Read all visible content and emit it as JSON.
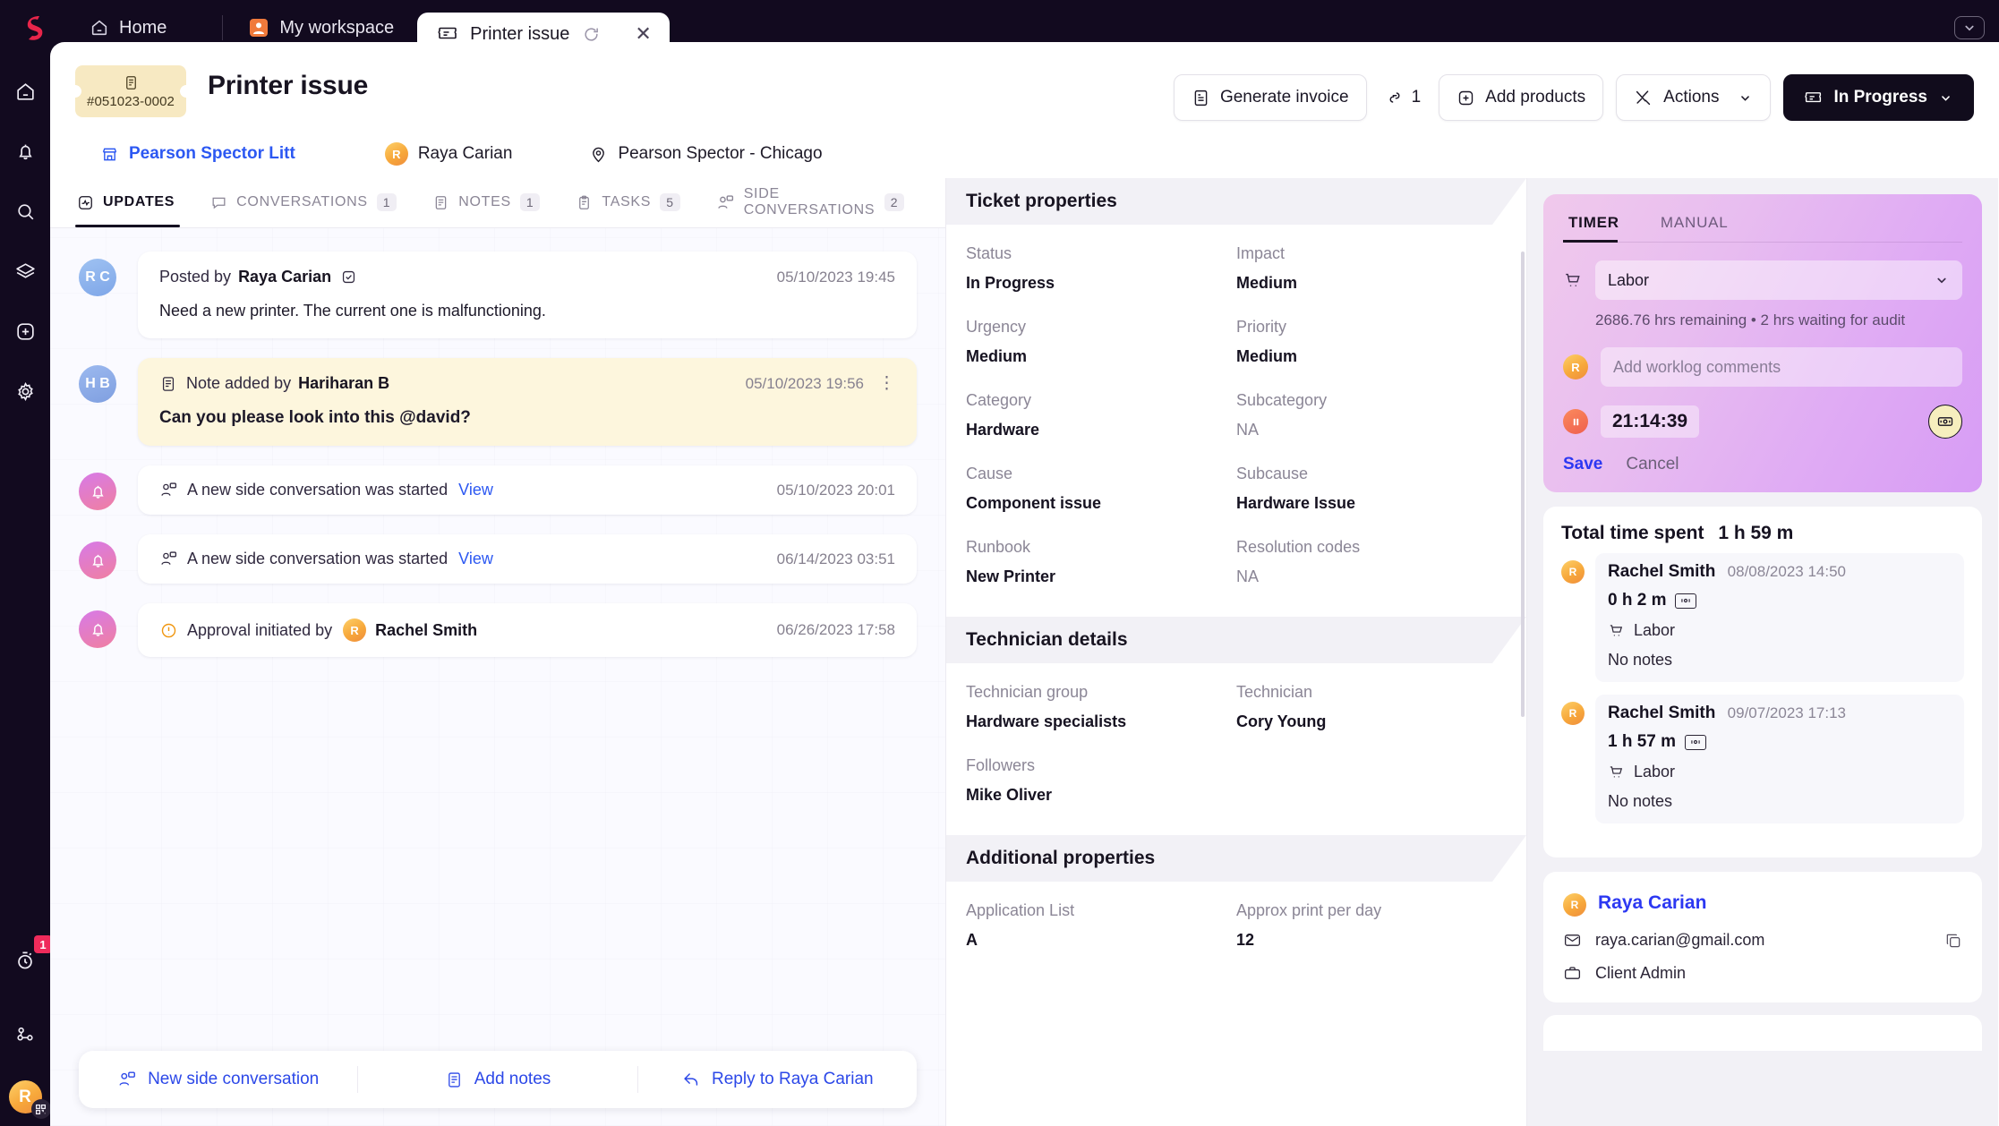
{
  "topbar": {
    "brand_icon": "sprinklr-logo-icon",
    "tabs": [
      {
        "label": "Home",
        "icon": "home-icon",
        "active": false
      },
      {
        "label": "My workspace",
        "icon": "workspace-person-icon",
        "active": false
      },
      {
        "label": "Printer issue",
        "icon": "ticket-icon",
        "active": true,
        "refresh_icon": "refresh-icon",
        "close_icon": "close-icon"
      }
    ],
    "right_control_icon": "chevron-down-box-icon"
  },
  "rail": {
    "items": [
      {
        "icon": "home-icon",
        "name": "home"
      },
      {
        "icon": "bell-icon",
        "name": "notifications"
      },
      {
        "icon": "search-icon",
        "name": "search"
      },
      {
        "icon": "layers-icon",
        "name": "layers"
      },
      {
        "icon": "plus-square-icon",
        "name": "create"
      },
      {
        "icon": "gear-icon",
        "name": "settings"
      }
    ],
    "timer_icon": "stopwatch-icon",
    "timer_badge": "1",
    "share_icon": "share-nodes-icon",
    "avatar_initial": "R",
    "avatar_qr_icon": "qr-code-icon"
  },
  "ticket": {
    "number": "#051023-0002",
    "chip_icon": "ticket-doc-icon",
    "title": "Printer issue",
    "account": {
      "label": "Pearson Spector Litt",
      "icon": "store-icon"
    },
    "requester": {
      "label": "Raya Carian",
      "avatar_initial": "R"
    },
    "location": {
      "label": "Pearson Spector - Chicago",
      "icon": "location-pin-icon"
    }
  },
  "header_actions": {
    "generate_invoice": {
      "label": "Generate invoice",
      "icon": "invoice-icon"
    },
    "attachments": {
      "count": "1",
      "icon": "paperclip-link-icon"
    },
    "add_products": {
      "label": "Add products",
      "icon": "plus-square-icon"
    },
    "actions": {
      "label": "Actions",
      "icon": "tools-icon",
      "caret": "chevron-down-icon"
    },
    "status": {
      "label": "In Progress",
      "icon": "ticket-icon",
      "caret": "chevron-down-icon"
    }
  },
  "view_tabs": [
    {
      "label": "UPDATES",
      "icon": "pulse-icon",
      "count": "",
      "active": true
    },
    {
      "label": "CONVERSATIONS",
      "icon": "chat-icon",
      "count": "1",
      "active": false
    },
    {
      "label": "NOTES",
      "icon": "note-icon",
      "count": "1",
      "active": false
    },
    {
      "label": "TASKS",
      "icon": "clipboard-icon",
      "count": "5",
      "active": false
    },
    {
      "label": "SIDE CONVERSATIONS",
      "icon": "people-chat-icon",
      "count": "2",
      "active": false
    }
  ],
  "feed": [
    {
      "type": "post",
      "avatar_initials": "R C",
      "avatar_style": "blue",
      "prefix": "Posted by",
      "author": "Raya Carian",
      "badge_icon": "verified-check-icon",
      "timestamp": "05/10/2023 19:45",
      "body": "Need a new printer. The current one is malfunctioning."
    },
    {
      "type": "note",
      "avatar_initials": "H B",
      "avatar_style": "blue2",
      "icon": "note-icon",
      "prefix": "Note added by",
      "author": "Hariharan B",
      "timestamp": "05/10/2023 19:56",
      "kebab_icon": "kebab-menu-icon",
      "body": "Can you please look into this @david?"
    },
    {
      "type": "event",
      "avatar_style": "pink",
      "avatar_icon": "bell-icon",
      "icon": "people-chat-icon",
      "text": "A new side conversation was started",
      "link": "View",
      "timestamp": "05/10/2023 20:01"
    },
    {
      "type": "event",
      "avatar_style": "pink",
      "avatar_icon": "bell-icon",
      "icon": "people-chat-icon",
      "text": "A new side conversation was started",
      "link": "View",
      "timestamp": "06/14/2023 03:51"
    },
    {
      "type": "approval",
      "avatar_style": "pink",
      "avatar_icon": "bell-icon",
      "icon": "alert-circle-icon",
      "text": "Approval initiated by",
      "author": "Rachel Smith",
      "author_avatar_initial": "R",
      "timestamp": "06/26/2023 17:58"
    }
  ],
  "bottom_actions": [
    {
      "label": "New side conversation",
      "icon": "people-chat-icon"
    },
    {
      "label": "Add notes",
      "icon": "note-icon"
    },
    {
      "label": "Reply to Raya Carian",
      "icon": "reply-icon"
    }
  ],
  "properties": {
    "sections": [
      {
        "title": "Ticket properties",
        "fields": [
          {
            "key": "Status",
            "value": "In Progress",
            "na": false
          },
          {
            "key": "Impact",
            "value": "Medium",
            "na": false
          },
          {
            "key": "Urgency",
            "value": "Medium",
            "na": false
          },
          {
            "key": "Priority",
            "value": "Medium",
            "na": false
          },
          {
            "key": "Category",
            "value": "Hardware",
            "na": false
          },
          {
            "key": "Subcategory",
            "value": "NA",
            "na": true
          },
          {
            "key": "Cause",
            "value": "Component issue",
            "na": false
          },
          {
            "key": "Subcause",
            "value": "Hardware Issue",
            "na": false
          },
          {
            "key": "Runbook",
            "value": "New Printer",
            "na": false
          },
          {
            "key": "Resolution codes",
            "value": "NA",
            "na": true
          }
        ]
      },
      {
        "title": "Technician details",
        "fields": [
          {
            "key": "Technician group",
            "value": "Hardware specialists",
            "na": false
          },
          {
            "key": "Technician",
            "value": "Cory Young",
            "na": false
          },
          {
            "key": "Followers",
            "value": "Mike Oliver",
            "na": false
          }
        ]
      },
      {
        "title": "Additional properties",
        "fields": [
          {
            "key": "Application List",
            "value": "A",
            "na": false
          },
          {
            "key": "Approx print per day",
            "value": "12",
            "na": false
          }
        ]
      }
    ]
  },
  "timer": {
    "tabs": [
      {
        "label": "TIMER",
        "active": true
      },
      {
        "label": "MANUAL",
        "active": false
      }
    ],
    "cart_icon": "cart-icon",
    "category": "Labor",
    "caret_icon": "chevron-down-icon",
    "meta": "2686.76 hrs remaining  •  2 hrs waiting for audit",
    "avatar_initial": "R",
    "comment_placeholder": "Add worklog comments",
    "elapsed": "21:14:39",
    "pause_icon": "pause-icon",
    "badge_icon": "billing-icon",
    "save_label": "Save",
    "cancel_label": "Cancel"
  },
  "worklog": {
    "title": "Total time spent",
    "total": "1 h 59 m",
    "entries": [
      {
        "avatar_initial": "R",
        "author": "Rachel Smith",
        "timestamp": "08/08/2023 14:50",
        "duration": "0 h 2 m",
        "billing_icon": "billing-icon",
        "tag_icon": "cart-icon",
        "tag": "Labor",
        "notes": "No notes"
      },
      {
        "avatar_initial": "R",
        "author": "Rachel Smith",
        "timestamp": "09/07/2023 17:13",
        "duration": "1 h 57 m",
        "billing_icon": "billing-icon",
        "tag_icon": "cart-icon",
        "tag": "Labor",
        "notes": "No notes"
      }
    ]
  },
  "contact": {
    "avatar_initial": "R",
    "name": "Raya Carian",
    "email": "raya.carian@gmail.com",
    "email_icon": "mail-icon",
    "copy_icon": "copy-icon",
    "role": "Client Admin",
    "role_icon": "briefcase-icon"
  },
  "colors": {
    "accent_blue": "#2c58f2",
    "dark": "#110c1c",
    "note_yellow": "#fdf6dd",
    "timer_purple": "#dfaaf4",
    "badge_red": "#ef2b5b",
    "ticket_chip": "#f7e9c2"
  }
}
